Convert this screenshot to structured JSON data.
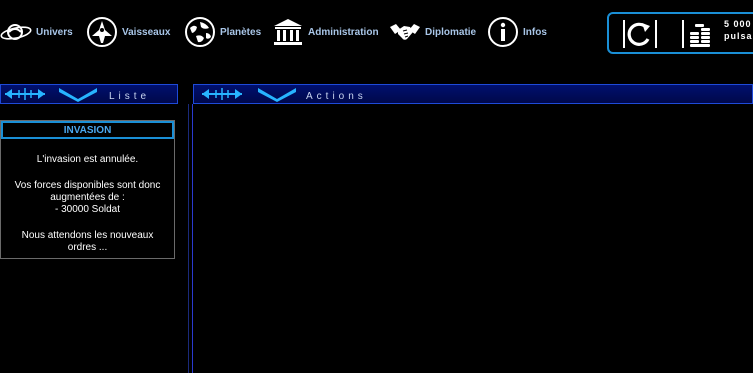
{
  "nav": {
    "items": [
      {
        "label": "Univers",
        "icon": "galaxy-icon"
      },
      {
        "label": "Vaisseaux",
        "icon": "spaceship-icon"
      },
      {
        "label": "Planètes",
        "icon": "planet-icon"
      },
      {
        "label": "Administration",
        "icon": "government-building-icon"
      },
      {
        "label": "Diplomatie",
        "icon": "handshake-icon"
      },
      {
        "label": "Infos",
        "icon": "info-icon"
      }
    ]
  },
  "resources": {
    "amount": "5 000",
    "unit": "pulsa",
    "refresh_icon": "refresh-icon",
    "coins_icon": "coins-icon"
  },
  "panels": {
    "list_title": "Liste",
    "actions_title": "Actions"
  },
  "invasion": {
    "title": "INVASION",
    "line1": "L'invasion est annulée.",
    "line2": "Vos forces disponibles sont donc augmentées de :",
    "line3": "- 30000 Soldat",
    "line4": "Nous attendons les nouveaux ordres ..."
  },
  "colors": {
    "accent": "#1a8fd6",
    "header_bg": "#00106e",
    "nav_text": "#a9c6e8"
  }
}
